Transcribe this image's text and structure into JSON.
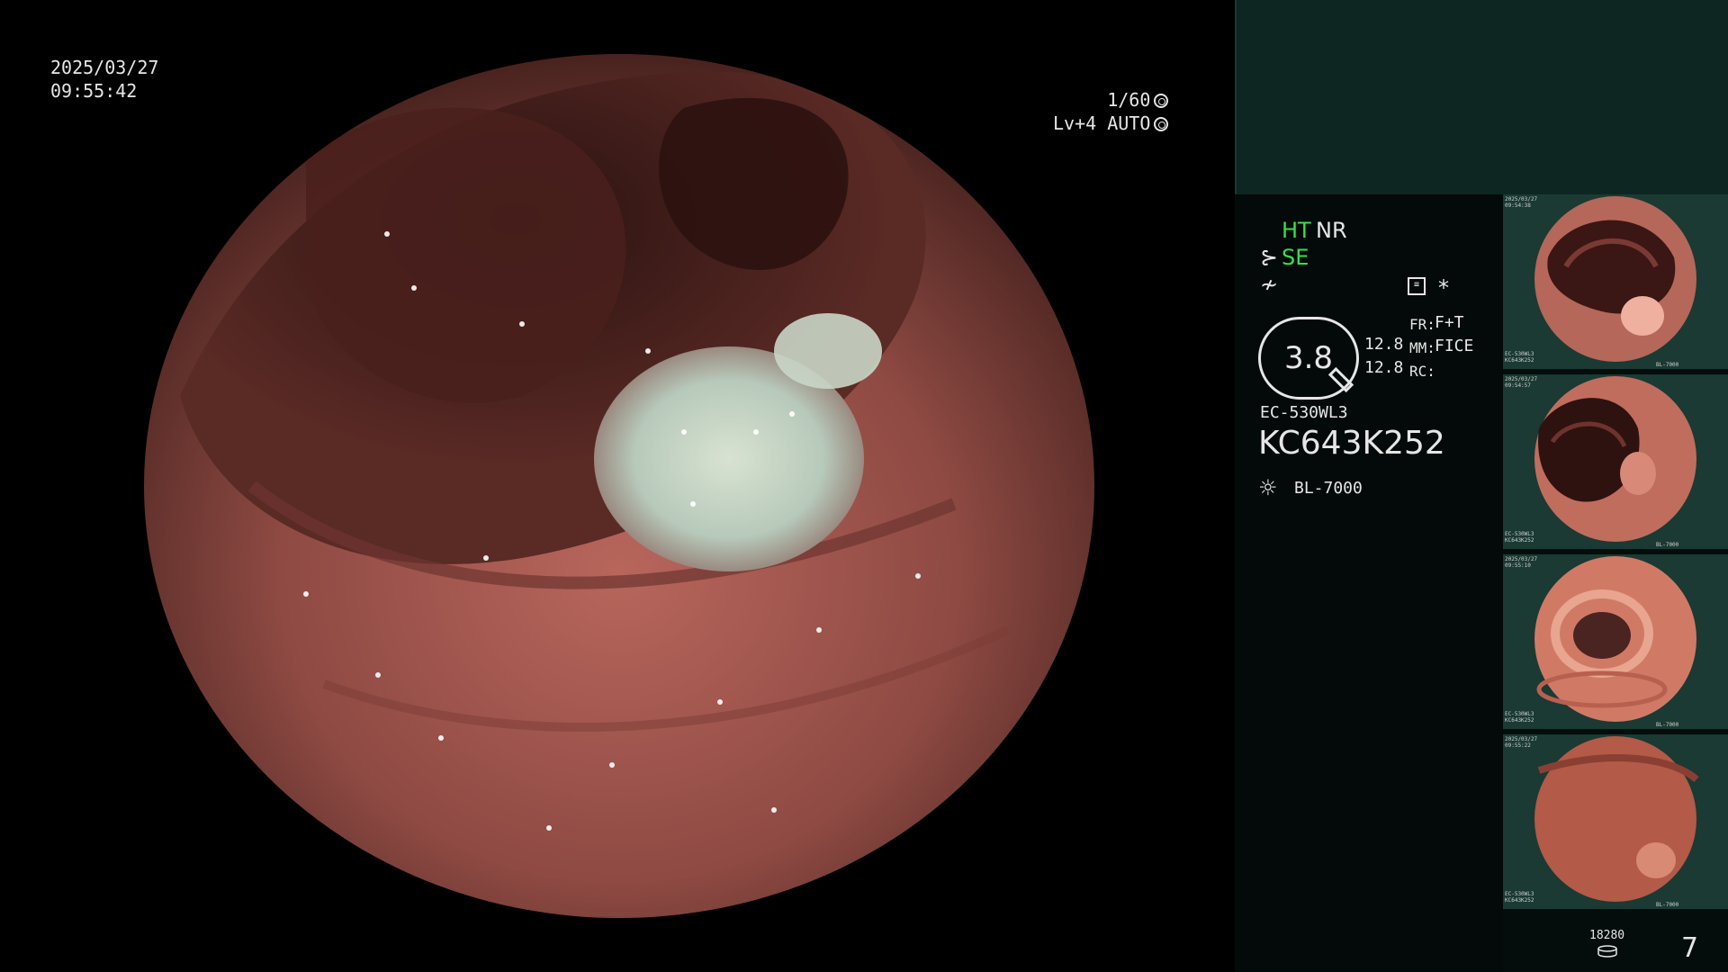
{
  "overlay": {
    "date": "2025/03/27",
    "time": "09:55:42",
    "shutter": "1/60",
    "level": "Lv+4 AUTO"
  },
  "info": {
    "ht": "HT",
    "nr": "NR",
    "se": "SE",
    "zoom_value": "3.8",
    "val1": "12.8",
    "val2": "12.8",
    "fr_label": "FR:",
    "fr_value": "F+T",
    "mm_label": "MM:",
    "mm_value": "FICE",
    "rc_label": "RC:",
    "scope_model": "EC-530WL3",
    "scope_serial": "KC643K252",
    "light_source": "BL-7000",
    "star": "*"
  },
  "thumbnails": [
    {
      "date": "2025/03/27",
      "time": "09:54:38",
      "model": "EC-530WL3",
      "serial": "KC643K252",
      "light": "BL-7000"
    },
    {
      "date": "2025/03/27",
      "time": "09:54:57",
      "model": "EC-530WL3",
      "serial": "KC643K252",
      "light": "BL-7000"
    },
    {
      "date": "2025/03/27",
      "time": "09:55:10",
      "model": "EC-530WL3",
      "serial": "KC643K252",
      "light": "BL-7000"
    },
    {
      "date": "2025/03/27",
      "time": "09:55:22",
      "model": "EC-530WL3",
      "serial": "KC643K252",
      "light": "BL-7000"
    }
  ],
  "footer": {
    "storage_count": "18280",
    "page_number": "7"
  },
  "colors": {
    "accent_green": "#36e04a",
    "panel_teal": "#0d2622",
    "panel_dark": "#030a09"
  }
}
